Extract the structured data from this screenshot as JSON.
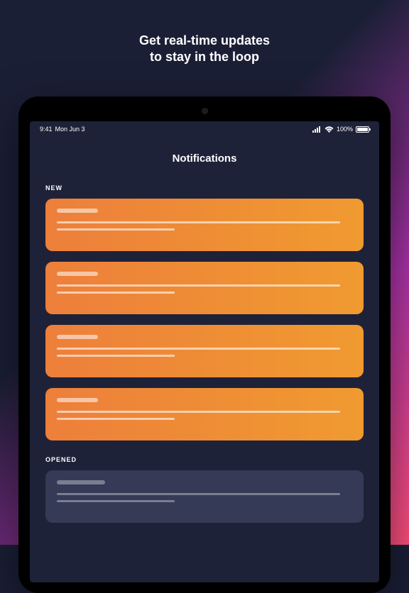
{
  "promo": {
    "line1": "Get real-time updates",
    "line2": "to stay in the loop"
  },
  "statusBar": {
    "time": "9:41",
    "date": "Mon Jun 3",
    "batteryText": "100%"
  },
  "page": {
    "title": "Notifications"
  },
  "sections": {
    "newLabel": "NEW",
    "openedLabel": "OPENED"
  }
}
